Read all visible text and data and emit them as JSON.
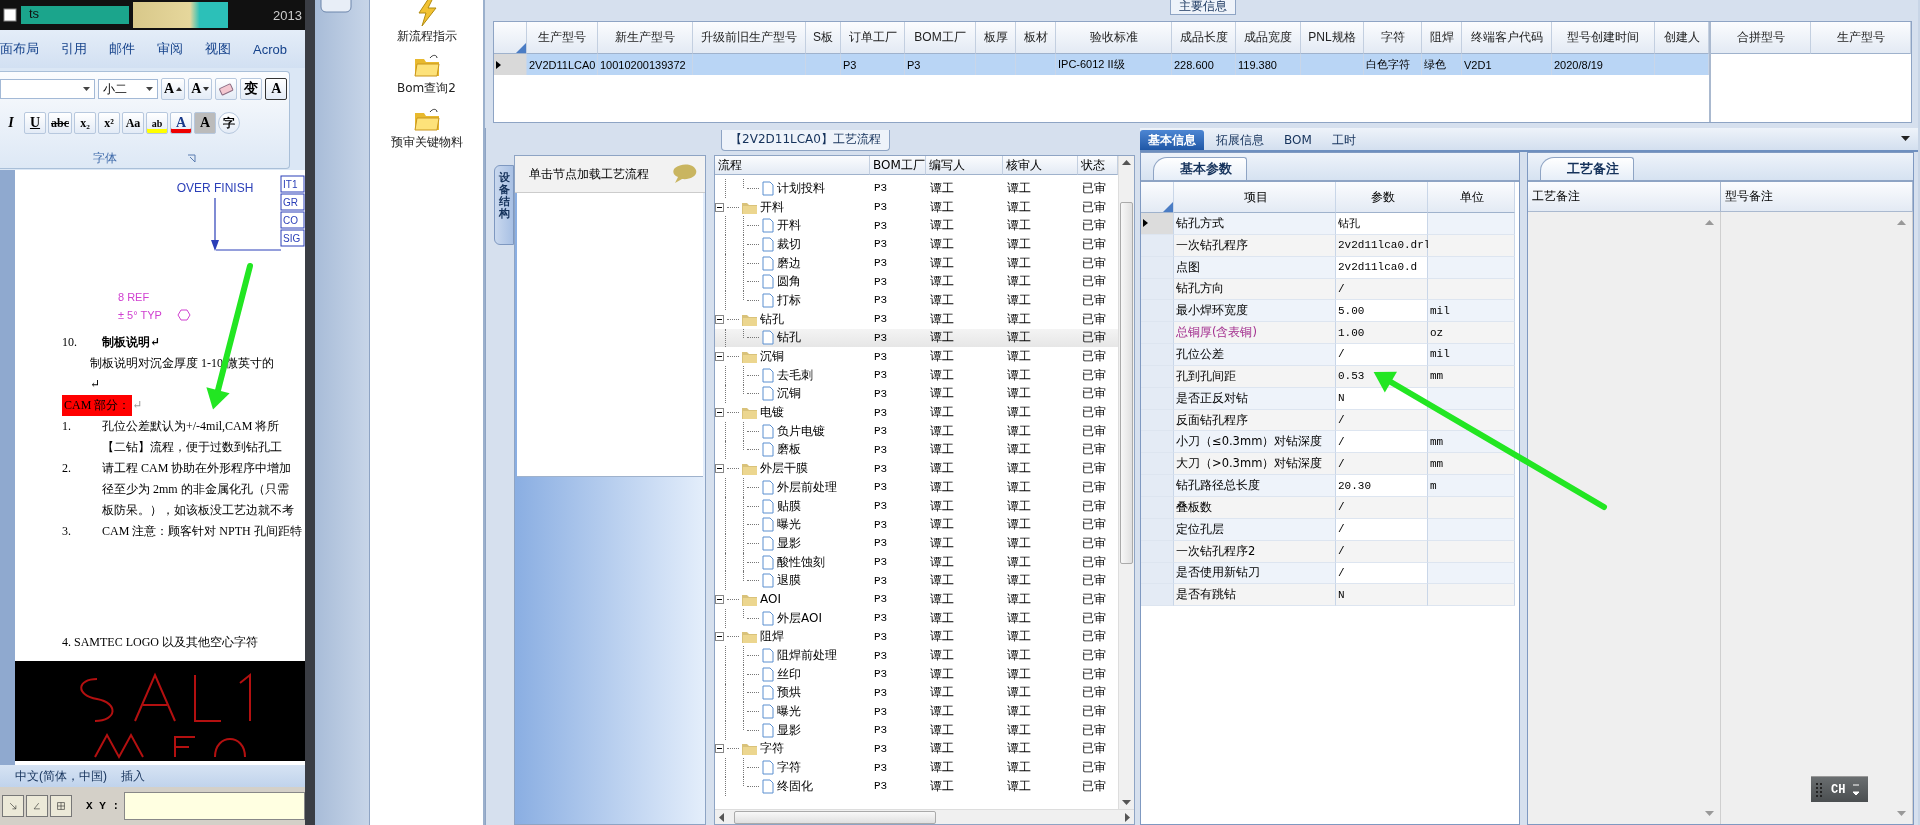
{
  "word": {
    "taskbar": {
      "button": "ts",
      "title": "2013"
    },
    "ribbon_tabs": [
      "面布局",
      "引用",
      "邮件",
      "审阅",
      "视图",
      "Acrob"
    ],
    "font_size": "小二",
    "font_tools": [
      {
        "kind": "grow",
        "text": "A"
      },
      {
        "kind": "shrink",
        "text": "A"
      },
      {
        "kind": "eraser"
      },
      {
        "kind": "phonetic",
        "text": "变"
      },
      {
        "kind": "boxed",
        "text": "A"
      }
    ],
    "format_tools": [
      {
        "kind": "italic",
        "text": "I"
      },
      {
        "kind": "underline",
        "text": "U"
      },
      {
        "kind": "strike",
        "text": "abc"
      },
      {
        "kind": "sub",
        "text": "x₂"
      },
      {
        "kind": "sup",
        "text": "x²"
      },
      {
        "kind": "case",
        "text": "Aa"
      },
      {
        "kind": "highlight",
        "text": "ab"
      },
      {
        "kind": "fontcolor",
        "text": "A"
      },
      {
        "kind": "shade",
        "text": "A"
      },
      {
        "kind": "circle",
        "text": "字"
      }
    ],
    "group_label": "字体",
    "drawing": {
      "note": "OVER FINISH",
      "boxes": [
        "IT1",
        "GR",
        "CO",
        "SIG"
      ],
      "ref": "8 REF",
      "angle": "± 5° TYP"
    },
    "blocks": [
      {
        "kind": "heading",
        "number": "10.",
        "text": "制板说明↵"
      },
      {
        "kind": "body",
        "text": "制板说明对沉金厚度 1-10 微英寸的"
      },
      {
        "kind": "body",
        "text": "↵"
      },
      {
        "kind": "flag",
        "text": "CAM 部分：",
        "tail": "↵"
      },
      {
        "kind": "item",
        "number": "1.",
        "lines": [
          "孔位公差默认为+/-4mil,CAM 将所",
          "【二钻】流程，便于过数到钻孔工"
        ]
      },
      {
        "kind": "item",
        "number": "2.",
        "lines": [
          "请工程 CAM 协助在外形程序中增加",
          "径至少为 2mm 的非金属化孔（只需",
          "板防呆。），如该板没工艺边就不考"
        ]
      },
      {
        "kind": "item",
        "number": "3.",
        "lines": [
          "CAM 注意：顾客针对 NPTH 孔间距特"
        ]
      },
      {
        "kind": "plain",
        "text": "4. SAMTEC LOGO 以及其他空心字符"
      },
      {
        "kind": "picture"
      }
    ],
    "status": [
      "中文(简体，中国)",
      "插入"
    ],
    "coord_label": "X Y :"
  },
  "tools": [
    {
      "kind": "lightning",
      "label": "新流程指示"
    },
    {
      "kind": "folder",
      "label": "Bom查询2"
    },
    {
      "kind": "folder",
      "label": "预审关键物料"
    }
  ],
  "main_info": {
    "tab": "主要信息",
    "columns": [
      "生产型号",
      "新生产型号",
      "升级前旧生产型号",
      "S板",
      "订单工厂",
      "BOM工厂",
      "板厚",
      "板材",
      "验收标准",
      "成品长度",
      "成品宽度",
      "PNL规格",
      "字符",
      "阻焊",
      "终端客户代码",
      "型号创建时间",
      "创建人"
    ],
    "rows": [
      {
        "selected": true,
        "cells": [
          "2V2D11LCA0",
          "10010200139372",
          null,
          null,
          "P3",
          "P3",
          null,
          null,
          "IPC-6012 II级",
          "228.600",
          "119.380",
          null,
          "白色字符",
          "绿色",
          "V2D1",
          "2020/8/19",
          null
        ]
      }
    ],
    "merge_columns": [
      "合拼型号",
      "生产型号"
    ]
  },
  "process": {
    "title": "【2V2D11LCA0】工艺流程",
    "side_tab": "设备结构",
    "hint": "单击节点加载工艺流程",
    "columns": [
      "流程",
      "BOM工厂",
      "编写人",
      "核审人",
      "状态"
    ],
    "tree": [
      {
        "children": [
          {
            "label": "计划投料",
            "bom": "P3",
            "writer": "谭工",
            "reviewer": "谭工",
            "status": "已审",
            "selected": false
          }
        ]
      },
      {
        "label": "开料",
        "bom": "P3",
        "writer": "谭工",
        "reviewer": "谭工",
        "status": "已审",
        "selected": false,
        "expanded": true,
        "children": [
          {
            "label": "开料",
            "bom": "P3",
            "writer": "谭工",
            "reviewer": "谭工",
            "status": "已审",
            "selected": false
          },
          {
            "label": "裁切",
            "bom": "P3",
            "writer": "谭工",
            "reviewer": "谭工",
            "status": "已审",
            "selected": false
          },
          {
            "label": "磨边",
            "bom": "P3",
            "writer": "谭工",
            "reviewer": "谭工",
            "status": "已审",
            "selected": false
          },
          {
            "label": "圆角",
            "bom": "P3",
            "writer": "谭工",
            "reviewer": "谭工",
            "status": "已审",
            "selected": false
          },
          {
            "label": "打标",
            "bom": "P3",
            "writer": "谭工",
            "reviewer": "谭工",
            "status": "已审",
            "selected": false
          }
        ]
      },
      {
        "label": "钻孔",
        "bom": "P3",
        "writer": "谭工",
        "reviewer": "谭工",
        "status": "已审",
        "selected": false,
        "expanded": true,
        "children": [
          {
            "label": "钻孔",
            "bom": "P3",
            "writer": "谭工",
            "reviewer": "谭工",
            "status": "已审",
            "selected": true
          }
        ]
      },
      {
        "label": "沉铜",
        "bom": "P3",
        "writer": "谭工",
        "reviewer": "谭工",
        "status": "已审",
        "selected": false,
        "expanded": true,
        "children": [
          {
            "label": "去毛刺",
            "bom": "P3",
            "writer": "谭工",
            "reviewer": "谭工",
            "status": "已审",
            "selected": false
          },
          {
            "label": "沉铜",
            "bom": "P3",
            "writer": "谭工",
            "reviewer": "谭工",
            "status": "已审",
            "selected": false
          }
        ]
      },
      {
        "label": "电镀",
        "bom": "P3",
        "writer": "谭工",
        "reviewer": "谭工",
        "status": "已审",
        "selected": false,
        "expanded": true,
        "children": [
          {
            "label": "负片电镀",
            "bom": "P3",
            "writer": "谭工",
            "reviewer": "谭工",
            "status": "已审",
            "selected": false
          },
          {
            "label": "磨板",
            "bom": "P3",
            "writer": "谭工",
            "reviewer": "谭工",
            "status": "已审",
            "selected": false
          }
        ]
      },
      {
        "label": "外层干膜",
        "bom": "P3",
        "writer": "谭工",
        "reviewer": "谭工",
        "status": "已审",
        "selected": false,
        "expanded": true,
        "children": [
          {
            "label": "外层前处理",
            "bom": "P3",
            "writer": "谭工",
            "reviewer": "谭工",
            "status": "已审",
            "selected": false
          },
          {
            "label": "贴膜",
            "bom": "P3",
            "writer": "谭工",
            "reviewer": "谭工",
            "status": "已审",
            "selected": false
          },
          {
            "label": "曝光",
            "bom": "P3",
            "writer": "谭工",
            "reviewer": "谭工",
            "status": "已审",
            "selected": false
          },
          {
            "label": "显影",
            "bom": "P3",
            "writer": "谭工",
            "reviewer": "谭工",
            "status": "已审",
            "selected": false
          },
          {
            "label": "酸性蚀刻",
            "bom": "P3",
            "writer": "谭工",
            "reviewer": "谭工",
            "status": "已审",
            "selected": false
          },
          {
            "label": "退膜",
            "bom": "P3",
            "writer": "谭工",
            "reviewer": "谭工",
            "status": "已审",
            "selected": false
          }
        ]
      },
      {
        "label": "AOI",
        "bom": "P3",
        "writer": "谭工",
        "reviewer": "谭工",
        "status": "已审",
        "selected": false,
        "expanded": true,
        "children": [
          {
            "label": "外层AOI",
            "bom": "P3",
            "writer": "谭工",
            "reviewer": "谭工",
            "status": "已审",
            "selected": false
          }
        ]
      },
      {
        "label": "阻焊",
        "bom": "P3",
        "writer": "谭工",
        "reviewer": "谭工",
        "status": "已审",
        "selected": false,
        "expanded": true,
        "children": [
          {
            "label": "阻焊前处理",
            "bom": "P3",
            "writer": "谭工",
            "reviewer": "谭工",
            "status": "已审",
            "selected": false
          },
          {
            "label": "丝印",
            "bom": "P3",
            "writer": "谭工",
            "reviewer": "谭工",
            "status": "已审",
            "selected": false
          },
          {
            "label": "预烘",
            "bom": "P3",
            "writer": "谭工",
            "reviewer": "谭工",
            "status": "已审",
            "selected": false
          },
          {
            "label": "曝光",
            "bom": "P3",
            "writer": "谭工",
            "reviewer": "谭工",
            "status": "已审",
            "selected": false
          },
          {
            "label": "显影",
            "bom": "P3",
            "writer": "谭工",
            "reviewer": "谭工",
            "status": "已审",
            "selected": false
          }
        ]
      },
      {
        "label": "字符",
        "bom": "P3",
        "writer": "谭工",
        "reviewer": "谭工",
        "status": "已审",
        "selected": false,
        "expanded": true,
        "children": [
          {
            "label": "字符",
            "bom": "P3",
            "writer": "谭工",
            "reviewer": "谭工",
            "status": "已审",
            "selected": false
          },
          {
            "label": "终固化",
            "bom": "P3",
            "writer": "谭工",
            "reviewer": "谭工",
            "status": "已审",
            "selected": false
          }
        ]
      }
    ]
  },
  "params": {
    "tabs": [
      {
        "label": "基本信息",
        "selected": true
      },
      {
        "label": "拓展信息",
        "selected": false
      },
      {
        "label": "BOM",
        "selected": false
      },
      {
        "label": "工时",
        "selected": false
      }
    ],
    "panel_tab": "基本参数",
    "columns": [
      "项目",
      "参数",
      "单位"
    ],
    "rows": [
      {
        "item": "钻孔方式",
        "value": "钻孔",
        "selected": true,
        "highlighted": false
      },
      {
        "item": "一次钻孔程序",
        "value": "2v2d11lca0.drl",
        "selected": false,
        "highlighted": false
      },
      {
        "item": "点图",
        "value": "2v2d11lca0.d",
        "selected": false,
        "highlighted": false
      },
      {
        "item": "钻孔方向",
        "value": "/",
        "selected": false,
        "highlighted": false
      },
      {
        "item": "最小焊环宽度",
        "value": "5.00",
        "unit": "mil",
        "selected": false,
        "highlighted": false
      },
      {
        "item": "总铜厚(含表铜)",
        "value": "1.00",
        "unit": "oz",
        "selected": false,
        "highlighted": true
      },
      {
        "item": "孔位公差",
        "value": "/",
        "unit": "mil",
        "selected": false,
        "highlighted": false
      },
      {
        "item": "孔到孔间距",
        "value": "0.53",
        "unit": "mm",
        "selected": false,
        "highlighted": false
      },
      {
        "item": "是否正反对钻",
        "value": "N",
        "selected": false,
        "highlighted": false
      },
      {
        "item": "反面钻孔程序",
        "value": "/",
        "selected": false,
        "highlighted": false
      },
      {
        "item": "小刀（≤0.3mm）对钻深度",
        "value": "/",
        "unit": "mm",
        "selected": false,
        "highlighted": false
      },
      {
        "item": "大刀（>0.3mm）对钻深度",
        "value": "/",
        "unit": "mm",
        "selected": false,
        "highlighted": false
      },
      {
        "item": "钻孔路径总长度",
        "value": "20.30",
        "unit": "m",
        "selected": false,
        "highlighted": false
      },
      {
        "item": "叠板数",
        "value": "/",
        "selected": false,
        "highlighted": false
      },
      {
        "item": "定位孔层",
        "value": "/",
        "selected": false,
        "highlighted": false
      },
      {
        "item": "一次钻孔程序2",
        "value": "/",
        "selected": false,
        "highlighted": false
      },
      {
        "item": "是否使用新钻刀",
        "value": "/",
        "selected": false,
        "highlighted": false
      },
      {
        "item": "是否有跳钻",
        "value": "N",
        "selected": false,
        "highlighted": false
      }
    ]
  },
  "remarks": {
    "tab": "工艺备注",
    "columns": [
      "工艺备注",
      "型号备注"
    ]
  },
  "language_bar": "CH"
}
